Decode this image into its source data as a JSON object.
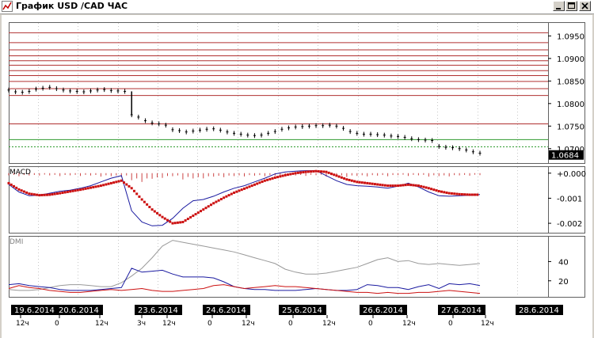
{
  "window": {
    "title": "График USD /CAD  ЧАС",
    "app_icon": "chart-icon",
    "controls": [
      "minimize-icon",
      "maximize-icon",
      "close-icon"
    ]
  },
  "colors": {
    "price_bar": "#000000",
    "resistance": "#b03030",
    "support_green": "#2e9a2e",
    "macd_line": "#1a1aa0",
    "macd_signal": "#cc1111",
    "hist": "#cc4444",
    "dmi_adx": "#999999",
    "dmi_plus": "#1a1aa0",
    "dmi_minus": "#cc1111",
    "axis_date_bg": "#000000",
    "axis_date_fg": "#ffffff"
  },
  "chart_data": [
    {
      "type": "line",
      "name_label": "",
      "price_label": "1.0684",
      "y_ticks": [
        "1.0950",
        "1.0900",
        "1.0850",
        "1.0800",
        "1.0750",
        "1.0700"
      ],
      "ylim": [
        1.0675,
        1.097
      ],
      "resistance_levels": [
        1.0957,
        1.0935,
        1.0919,
        1.0906,
        1.0895,
        1.0885,
        1.0873,
        1.0862,
        1.0849,
        1.0833,
        1.0818,
        1.0755
      ],
      "green_levels": [
        1.072
      ],
      "dotted_levels": [
        1.0704
      ],
      "series": [
        {
          "values": [
            1.083,
            1.0826,
            1.0825,
            1.0827,
            1.0832,
            1.0834,
            1.0836,
            1.0833,
            1.083,
            1.0828,
            1.0827,
            1.0826,
            1.0828,
            1.083,
            1.0831,
            1.0829,
            1.0828,
            1.0827,
            1.0775,
            1.077,
            1.0762,
            1.0757,
            1.0755,
            1.0752,
            1.0742,
            1.074,
            1.0737,
            1.0739,
            1.0741,
            1.0743,
            1.0744,
            1.0741,
            1.0737,
            1.0734,
            1.0732,
            1.073,
            1.0729,
            1.073,
            1.0734,
            1.0738,
            1.0743,
            1.0746,
            1.0748,
            1.0749,
            1.075,
            1.0751,
            1.0751,
            1.0752,
            1.075,
            1.0745,
            1.0738,
            1.0734,
            1.0732,
            1.0732,
            1.0731,
            1.073,
            1.0728,
            1.0727,
            1.0725,
            1.0722,
            1.072,
            1.0719,
            1.0718,
            1.0705,
            1.0703,
            1.0702,
            1.07,
            1.0697,
            1.0693,
            1.069
          ]
        }
      ]
    },
    {
      "type": "line",
      "name_label": "MACD",
      "y_ticks": [
        "+0.000",
        "-0.001",
        "-0.002"
      ],
      "ylim": [
        -0.00225,
        0.00015
      ],
      "series": [
        {
          "values": [
            -0.00045,
            -0.00075,
            -0.0009,
            -0.00088,
            -0.0008,
            -0.00072,
            -0.00068,
            -0.0006,
            -0.0005,
            -0.00035,
            -0.0002,
            -0.0001,
            -0.0015,
            -0.00195,
            -0.0021,
            -0.00208,
            -0.0018,
            -0.0014,
            -0.0011,
            -0.00105,
            -0.00092,
            -0.00075,
            -0.0006,
            -0.0005,
            -0.00035,
            -0.0002,
            -3e-05,
            5e-05,
            8e-05,
            0.0001,
            0.0001,
            -0.0001,
            -0.0003,
            -0.00045,
            -0.0005,
            -0.00052,
            -0.00055,
            -0.0006,
            -0.00052,
            -0.0004,
            -0.00055,
            -0.00075,
            -0.0009,
            -0.00092,
            -0.0009,
            -0.00088,
            -0.00085
          ]
        },
        {
          "values": [
            -0.0004,
            -0.00065,
            -0.00082,
            -0.00088,
            -0.00086,
            -0.0008,
            -0.00073,
            -0.00066,
            -0.00058,
            -0.0005,
            -0.0004,
            -0.0003,
            -0.0006,
            -0.00105,
            -0.00145,
            -0.00175,
            -0.002,
            -0.00195,
            -0.0017,
            -0.00145,
            -0.0012,
            -0.00098,
            -0.00078,
            -0.00062,
            -0.00046,
            -0.0003,
            -0.00018,
            -8e-05,
            0.0,
            5e-05,
            8e-05,
            5e-05,
            -0.0001,
            -0.00025,
            -0.00035,
            -0.0004,
            -0.00045,
            -0.0005,
            -0.0005,
            -0.00046,
            -0.0005,
            -0.0006,
            -0.00072,
            -0.0008,
            -0.00084,
            -0.00086,
            -0.00086
          ]
        }
      ]
    },
    {
      "type": "line",
      "name_label": "DMI",
      "y_ticks": [
        "40",
        "20"
      ],
      "ylim": [
        5,
        65
      ],
      "series": [
        {
          "values": [
            11,
            10,
            10,
            11,
            13,
            15,
            16,
            16,
            15,
            14,
            14,
            18,
            25,
            33,
            44,
            56,
            62,
            60,
            58,
            56,
            54,
            52,
            50,
            47,
            44,
            41,
            38,
            32,
            29,
            27,
            27,
            28,
            30,
            32,
            34,
            38,
            42,
            44,
            40,
            41,
            38,
            37,
            38,
            37,
            36,
            37,
            38
          ]
        },
        {
          "values": [
            16,
            17,
            15,
            14,
            13,
            11,
            10,
            10,
            10,
            11,
            12,
            13,
            33,
            29,
            30,
            31,
            27,
            24,
            24,
            24,
            23,
            19,
            14,
            12,
            11,
            11,
            10,
            10,
            10,
            11,
            12,
            11,
            10,
            10,
            11,
            16,
            15,
            13,
            13,
            11,
            14,
            16,
            12,
            17,
            16,
            17,
            15
          ]
        },
        {
          "values": [
            12,
            15,
            13,
            12,
            10,
            9,
            8,
            8,
            9,
            10,
            11,
            10,
            11,
            12,
            10,
            9,
            9,
            10,
            11,
            12,
            15,
            16,
            14,
            12,
            13,
            14,
            15,
            14,
            14,
            13,
            12,
            11,
            10,
            9,
            8,
            8,
            7,
            8,
            7,
            7,
            8,
            8,
            9,
            10,
            9,
            8,
            7
          ]
        }
      ]
    }
  ],
  "x_axis": {
    "dates": [
      {
        "label": "19.6.2014"
      },
      {
        "label": "20.6.2014"
      },
      {
        "label": "23.6.2014"
      },
      {
        "label": "24.6.2014"
      },
      {
        "label": "25.6.2014"
      },
      {
        "label": "26.6.2014"
      },
      {
        "label": "27.6.2014"
      },
      {
        "label": "28.6.2014"
      }
    ],
    "hours": [
      "12ч",
      "0",
      "12ч",
      "3ч",
      "12ч",
      "0",
      "12ч",
      "0",
      "12ч",
      "0",
      "12ч",
      "0",
      "12ч"
    ]
  }
}
